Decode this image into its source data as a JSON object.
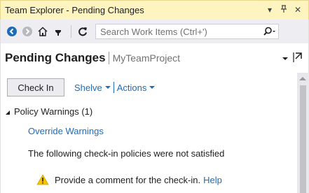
{
  "window": {
    "title": "Team Explorer - Pending Changes",
    "dropdown_glyph": "▾",
    "pin_glyph": "ᵦ",
    "close_glyph": "✕"
  },
  "toolbar": {
    "search_placeholder": "Search Work Items (Ctrl+')"
  },
  "header": {
    "title": "Pending Changes",
    "project": "MyTeamProject"
  },
  "actions": {
    "check_in": "Check In",
    "shelve": "Shelve",
    "actions": "Actions"
  },
  "policy_warnings": {
    "header": "Policy Warnings (1)",
    "override": "Override Warnings",
    "message": "The following check-in policies were not satisfied",
    "warning_text": "Provide a comment for the check-in.",
    "help_link": "Help"
  },
  "colors": {
    "titlebar_bg": "#fdf4bf",
    "link": "#1e6bb8",
    "toolbar_bg": "#eeeef2",
    "warning": "#f5c400"
  }
}
